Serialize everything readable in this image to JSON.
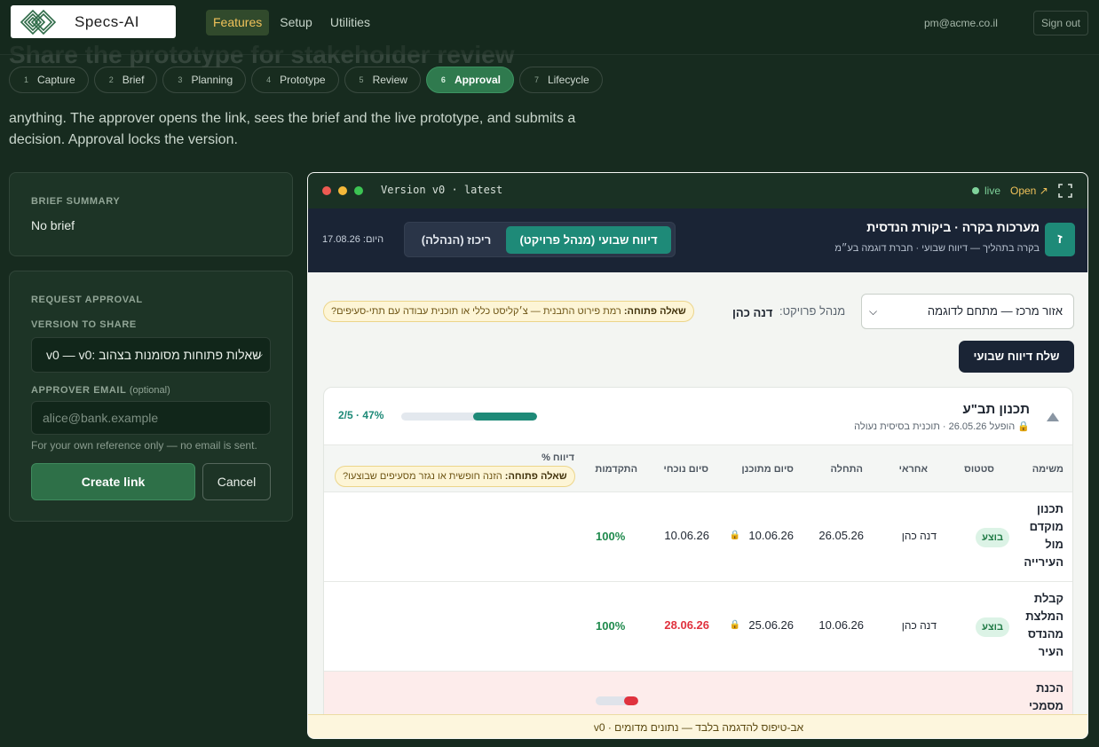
{
  "brand": {
    "name": "Specs-AI"
  },
  "nav": {
    "links": [
      {
        "label": "Features",
        "active": true
      },
      {
        "label": "Setup"
      },
      {
        "label": "Utilities"
      }
    ],
    "user_email": "pm@acme.co.il",
    "sign_out": "Sign out"
  },
  "page": {
    "heading_fragment": "Share the prototype for stakeholder review",
    "intro": "anything. The approver opens the link, sees the brief and the live prototype, and submits a decision. Approval locks the version."
  },
  "steps": [
    {
      "num": "1",
      "label": "Capture"
    },
    {
      "num": "2",
      "label": "Brief"
    },
    {
      "num": "3",
      "label": "Planning"
    },
    {
      "num": "4",
      "label": "Prototype"
    },
    {
      "num": "5",
      "label": "Review"
    },
    {
      "num": "6",
      "label": "Approval",
      "active": true
    },
    {
      "num": "7",
      "label": "Lifecycle"
    }
  ],
  "brief_summary": {
    "label": "BRIEF SUMMARY",
    "value": "No brief"
  },
  "request": {
    "section_label": "REQUEST APPROVAL",
    "version_label": "VERSION TO SHARE",
    "version_value": "v0 — v0: שאלות פתוחות מסומנות בצהוב",
    "email_label": "APPROVER EMAIL",
    "email_optional": "(optional)",
    "email_placeholder": "alice@bank.example",
    "hint": "For your own reference only — no email is sent.",
    "create_button": "Create link",
    "cancel_button": "Cancel"
  },
  "preview": {
    "title": "Version v0 · latest",
    "live": "live",
    "open": "Open ↗",
    "app": {
      "logo_letter": "ז",
      "title": "מערכות בקרה · ביקורת הנדסית",
      "subtitle": "בקרה בתהליך — דיווח שבועי · חברת דוגמה בע״מ",
      "tab_active": "דיווח שבועי (מנהל פרויקט)",
      "tab_other": "ריכוז (הנהלה)",
      "date": "היום: 17.08.26",
      "area_select": "אזור מרכז — מתחם לדוגמה",
      "pm_label": "מנהל פרויקט:",
      "pm_name": "דנה כהן",
      "open_question_top_bold": "שאלה פתוחה:",
      "open_question_top_text": " רמת פירוט התבנית — צ׳קליסט כללי או תוכנית עבודה עם תתי-סעיפים?",
      "send_button": "שלח דיווח שבועי",
      "phase": {
        "title": "תכנון תב\"ע",
        "meta": "הופעל 26.05.26 · תוכנית בסיסית נעולה",
        "pct_label": "2/5 · 47%",
        "pct": 47
      },
      "columns": [
        "משימה",
        "סטטוס",
        "אחראי",
        "התחלה",
        "סיום מתוכנן",
        "סיום נוכחי",
        "התקדמות",
        "דיווח %"
      ],
      "open_question_col_bold": "שאלה פתוחה:",
      "open_question_col_text": " הזנה חופשית או נגזר מסעיפים שבוצעו?",
      "rows": [
        {
          "task": "תכנון מוקדם מול העירייה",
          "status": "בוצע",
          "owner": "דנה כהן",
          "start": "26.05.26",
          "planned": "10.06.26",
          "actual": "10.06.26",
          "late": false,
          "progress": "100%"
        },
        {
          "task": "קבלת המלצת מהנדס העיר",
          "status": "בוצע",
          "owner": "דנה כהן",
          "start": "10.06.26",
          "planned": "25.06.26",
          "actual": "28.06.26",
          "late": true,
          "progress": "100%"
        },
        {
          "task": "הכנת מסמכי",
          "status": "",
          "owner": "",
          "start": "",
          "planned": "",
          "actual": "",
          "late": false,
          "progress": ""
        }
      ]
    },
    "footer": "אב-טיפוס להדגמה בלבד — נתונים מדומים · v0"
  }
}
